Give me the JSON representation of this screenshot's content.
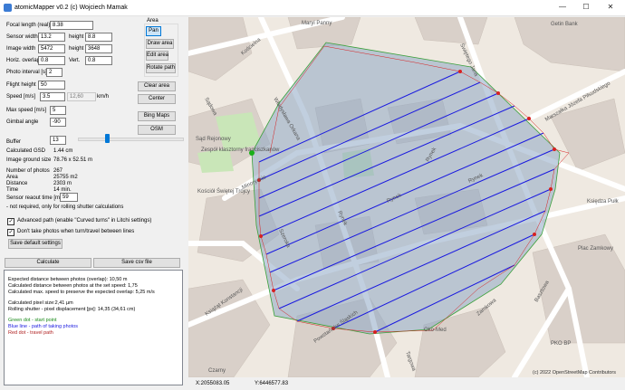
{
  "window": {
    "title": "atomicMapper v0.2 (c) Wojciech Mamak",
    "min": "—",
    "max": "☐",
    "close": "✕"
  },
  "params": {
    "focal_length_label": "Focal length (real)",
    "focal_length": "8.38",
    "sensor_width_label": "Sensor width",
    "sensor_width": "13.2",
    "height_label": "height",
    "sensor_height": "8.8",
    "image_width_label": "Image width",
    "image_width": "5472",
    "image_height": "3648",
    "horiz_overlap_label": "Horiz. overlap",
    "horiz_overlap": "0.8",
    "vert_label": "Vert.",
    "vert_overlap": "0.8",
    "photo_interval_label": "Photo interval [s]",
    "photo_interval": "2",
    "flight_height_label": "Flight height",
    "flight_height": "50",
    "speed_label": "Speed [m/s]",
    "speed": "3.5",
    "speed_kmh": "12,60",
    "kmh_label": "km/h",
    "max_speed_label": "Max speed [m/s]",
    "max_speed": "5",
    "gimbal_label": "Gimbal angle",
    "gimbal": "-90",
    "buffer_label": "Buffer",
    "buffer": "13"
  },
  "results": {
    "gsd_label": "Calculated GSD",
    "gsd": "1.44 cm",
    "size_label": "Image ground size",
    "size": "78.76 x 52.51 m",
    "photos_label": "Number of photos",
    "photos": "267",
    "area_label": "Area",
    "area": "25755 m2",
    "distance_label": "Distance",
    "distance": "2303 m",
    "time_label": "Time",
    "time": "14 min.",
    "readout_label": "Sensor reaout time [ms]",
    "readout": "59",
    "readout_note": "- not required, only for rolling shutter calculations"
  },
  "options": {
    "advanced_path": "Advanced path (enable \"Curved turns\" in Litchi settings)",
    "advanced_checked": "✓",
    "no_photos": "Don't take photos when turn/travel between lines",
    "no_photos_checked": "✓",
    "save_defaults": "Save default settings",
    "calculate": "Calculate",
    "save_csv": "Save csv file"
  },
  "area_panel": {
    "title": "Area",
    "pan": "Pan",
    "draw": "Draw area",
    "edit": "Edit area",
    "rotate": "Rotate path",
    "clear": "Clear area",
    "center": "Center",
    "bing": "Bing Maps",
    "osm": "OSM"
  },
  "log": {
    "l1": "Expected distance between photos (overlap): 10,50 m",
    "l2": "Calculated distance between photos at the set speed: 1,75",
    "l3": "Calculated max. speed to preserve the expected overlap: 5,25 m/s",
    "l4": "Calculated pixel size:2,41 µm",
    "l5": "Rolling shutter - pixel displacement [px]: 14,35 (34,61 cm)",
    "l6": "Green dot - start point",
    "l7": "Blue line - path of taking photos",
    "l8": "Red dot - travel path"
  },
  "map": {
    "streets": {
      "kosciuszki": "Kościelna",
      "sadowa": "Sądowa",
      "wladyslawa": "Władysława Orkana",
      "swietego": "Świętego Jana",
      "marszalka": "Marszałka Józefa Piłsudskiego",
      "ksiedza": "Księdza Pułk",
      "minoryckie": "Minoryckie",
      "rynek1": "Rynek",
      "rynek2": "Rynek",
      "rynek3": "Rynek",
      "rynek4": "Rynek",
      "szeroka": "Szeroka",
      "kniazi": "Książąt Konstancji",
      "powstancow": "Powstańców Śląskich",
      "zamkowa": "Zamkowa",
      "torgowa": "Targowa",
      "basztowa": "Basztowa"
    },
    "pois": {
      "maryi": "Maryi Panny",
      "getin": "Getin Bank",
      "sad": "Sąd Rejonowy",
      "zespol": "Zespół klasztorny franciszkanów",
      "kosciol": "Kościół Świętej Trójcy",
      "plac": "Plac Zamkowy",
      "pko": "PKO BP",
      "oko": "Oko-Med",
      "czarny": "Czarny"
    },
    "attribution": "(c) 2022 OpenStreetMap Contributors"
  },
  "status": {
    "x": "X:2055083.05",
    "y": "Y:6446577.83"
  },
  "colors": {
    "path": "#1a1adf",
    "area": "#3aa03a",
    "travel": "#d82020",
    "start": "#18b018"
  }
}
